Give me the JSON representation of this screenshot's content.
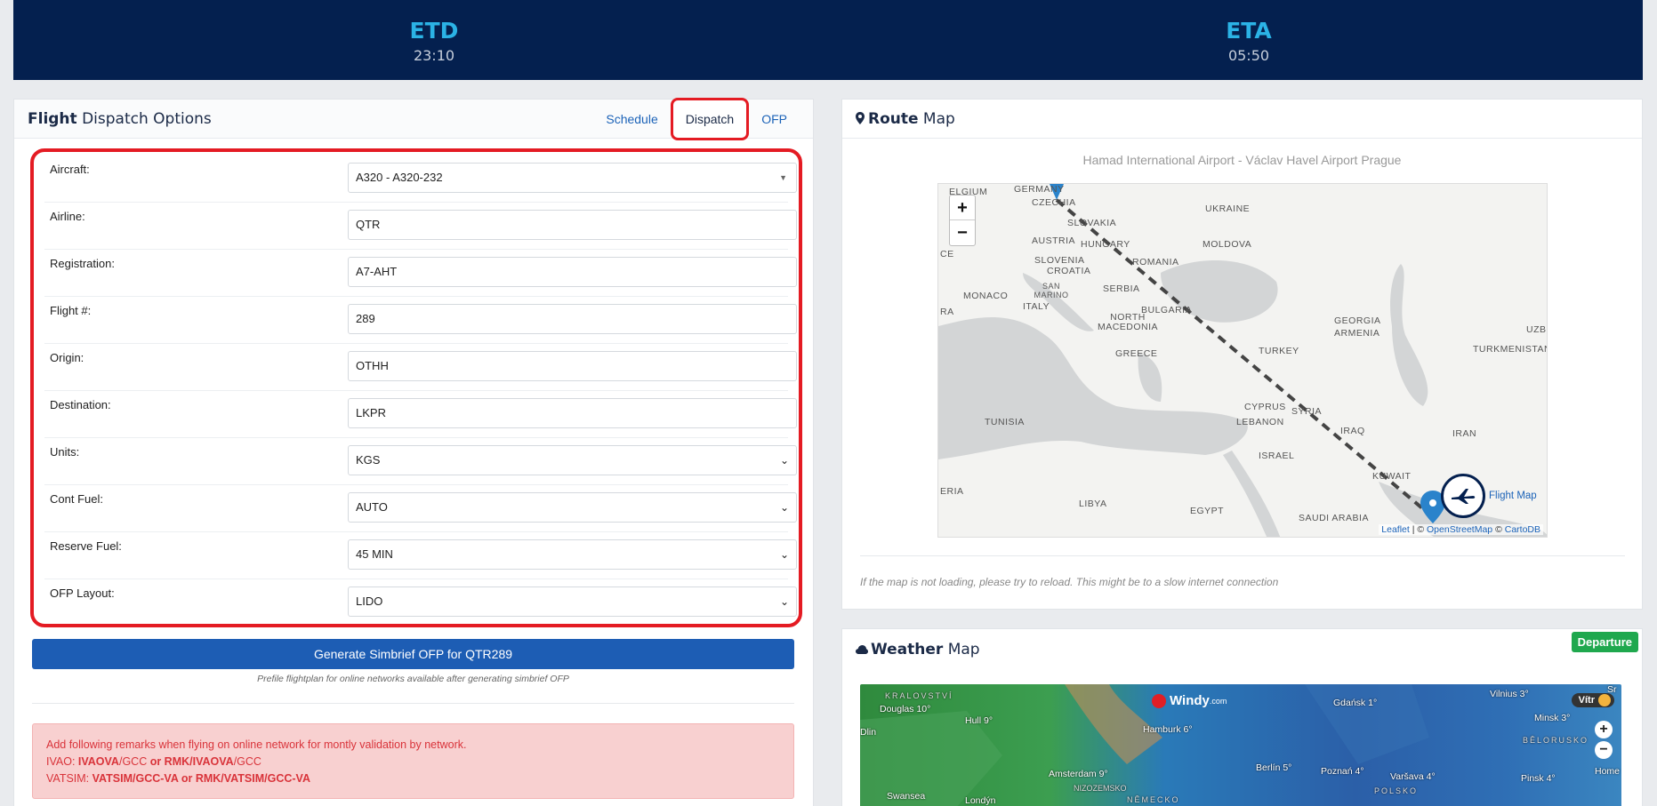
{
  "header": {
    "etd_label": "ETD",
    "etd_value": "23:10",
    "eta_label": "ETA",
    "eta_value": "05:50"
  },
  "dispatch": {
    "title_bold": "Flight",
    "title_rest": " Dispatch Options",
    "tabs": [
      "Schedule",
      "Dispatch",
      "OFP"
    ],
    "active_tab": "Dispatch",
    "fields": {
      "aircraft": {
        "label": "Aircraft:",
        "value": "A320 - A320-232"
      },
      "airline": {
        "label": "Airline:",
        "value": "QTR"
      },
      "registration": {
        "label": "Registration:",
        "value": "A7-AHT"
      },
      "flight": {
        "label": "Flight #:",
        "value": "289"
      },
      "origin": {
        "label": "Origin:",
        "value": "OTHH"
      },
      "destination": {
        "label": "Destination:",
        "value": "LKPR"
      },
      "units": {
        "label": "Units:",
        "value": "KGS"
      },
      "cont_fuel": {
        "label": "Cont Fuel:",
        "value": "AUTO"
      },
      "reserve_fuel": {
        "label": "Reserve Fuel:",
        "value": "45 MIN"
      },
      "ofp_layout": {
        "label": "OFP Layout:",
        "value": "LIDO"
      }
    },
    "generate_button": "Generate Simbrief OFP for QTR289",
    "prefile_note": "Prefile flightplan for online networks available after generating simbrief OFP",
    "remarks": {
      "intro": "Add following remarks when flying on online network for montly validation by network.",
      "ivao_prefix": "IVAO: ",
      "ivao_code1": "IVAOVA",
      "ivao_mid1": "/GCC ",
      "ivao_or": "or",
      "ivao_code2": " RMK/IVAOVA",
      "ivao_end": "/GCC",
      "vatsim_prefix": "VATSIM: ",
      "vatsim_code1": "VATSIM",
      "vatsim_mid1": "/GCC-VA ",
      "vatsim_or": "or",
      "vatsim_code2": " RMK/VATSIM",
      "vatsim_end": "/GCC-VA"
    }
  },
  "route_map": {
    "title_bold": "Route",
    "title_rest": " Map",
    "subtitle": "Hamad International Airport - Václav Havel Airport Prague",
    "countries": [
      "UKRAINE",
      "SLOVAKIA",
      "AUSTRIA",
      "HUNGARY",
      "MOLDOVA",
      "SLOVENIA",
      "CROATIA",
      "ROMANIA",
      "SAN MARINO",
      "SERBIA",
      "MONACO",
      "ITALY",
      "BULGARIA",
      "NORTH MACEDONIA",
      "GEORGIA",
      "ARMENIA",
      "TURKMENISTAN",
      "GREECE",
      "TURKEY",
      "TUNISIA",
      "CYPRUS",
      "SYRIA",
      "LEBANON",
      "IRAQ",
      "IRAN",
      "ISRAEL",
      "KUWAIT",
      "LIBYA",
      "EGYPT",
      "SAUDI ARABIA",
      "CZECHIA",
      "ELGIUM",
      "GERMANY",
      "UZBE",
      "RA",
      "ERIA",
      "CE"
    ],
    "flight_map_label": "Flight Map",
    "attribution": {
      "leaflet": "Leaflet",
      "sep1": " | © ",
      "osm": "OpenStreetMap",
      "sep2": " © ",
      "carto": "CartoDB"
    },
    "note": "If the map is not loading, please try to reload. This might be to a slow internet connection"
  },
  "weather_map": {
    "title_bold": "Weather",
    "title_rest": " Map",
    "badge": "Departure",
    "brand": "Windy",
    "brand_suffix": ".com",
    "places": [
      "Douglas 10°",
      "Hull 9°",
      "Hamburk 6°",
      "Gdańsk 1°",
      "Vilnius 3°",
      "Minsk 3°",
      "Amsterdam 9°",
      "Berlín 5°",
      "Poznań 4°",
      "Varšava 4°",
      "Pinsk 4°",
      "Swansea",
      "Londýn",
      "KRALOVSTVÍ",
      "Dlin",
      "NIZOZEMSKO",
      "NĚMECKO",
      "POLSKO",
      "BĚLORUSKO",
      "Sr",
      "Home"
    ],
    "widget_label": "Vítr"
  },
  "colors": {
    "navy": "#04204f",
    "accent": "#2bb3e6",
    "red_outline": "#e41b23",
    "primary": "#1d5db4",
    "success": "#1fa84e"
  }
}
